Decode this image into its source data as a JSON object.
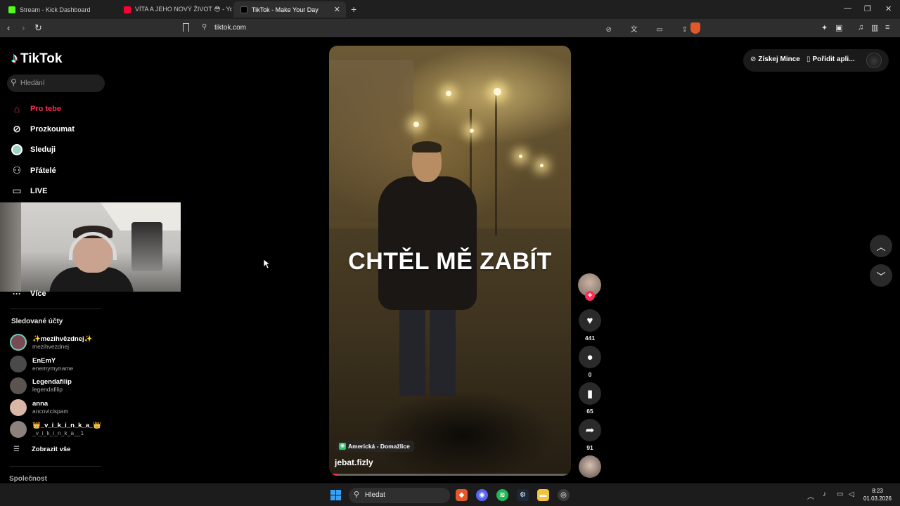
{
  "browser": {
    "tabs": [
      {
        "title": "Stream - Kick Dashboard",
        "favicon_color": "#53fc18",
        "active": false
      },
      {
        "title": "VÍTA A JEHO NOVÝ ŽIVOT 😳 - YouT",
        "favicon_color": "#ff0033",
        "active": false
      },
      {
        "title": "TikTok - Make Your Day",
        "favicon_color": "#ffffff",
        "active": true
      }
    ],
    "url": "tiktok.com"
  },
  "sidebar": {
    "brand": "TikTok",
    "search_placeholder": "Hledání",
    "nav": [
      {
        "label": "Pro tebe",
        "icon": "home-icon",
        "active": true
      },
      {
        "label": "Prozkoumat",
        "icon": "compass-icon",
        "active": false
      },
      {
        "label": "Sleduji",
        "icon": "following-icon",
        "active": false
      },
      {
        "label": "Přátelé",
        "icon": "friends-icon",
        "active": false
      },
      {
        "label": "LIVE",
        "icon": "live-icon",
        "active": false
      }
    ],
    "more_label": "Více",
    "following_header": "Sledované účty",
    "following": [
      {
        "name": "✨mezihvězdnej✨",
        "username": "mezihvezdnej",
        "avatar_color": "#7a4a52"
      },
      {
        "name": "EnEmY",
        "username": "enemymyname",
        "avatar_color": "#4a4a4a"
      },
      {
        "name": "Legendafilip",
        "username": "legendafilip",
        "avatar_color": "#5b5350"
      },
      {
        "name": "anna",
        "username": "ancovicispam",
        "avatar_color": "#d8b7a6"
      },
      {
        "name": "👑_v_i_k_i_n_k_a_👑",
        "username": "_v_i_k_i_n_k_a__1",
        "avatar_color": "#8c817d"
      }
    ],
    "show_all": "Zobrazit vše",
    "company": "Společnost"
  },
  "video": {
    "caption": "CHTĚL MĚ ZABÍT",
    "location": "Americká - Domažlice",
    "author": "jebat.fizly",
    "progress": 0.02
  },
  "actions": {
    "likes": "441",
    "comments": "0",
    "saves": "65",
    "shares": "91"
  },
  "topbar": {
    "coins": "Získej Mince",
    "get_app": "Pořídit apli..."
  },
  "taskbar": {
    "search": "Hledat",
    "time": "8:23",
    "date": "01.03.2026"
  }
}
